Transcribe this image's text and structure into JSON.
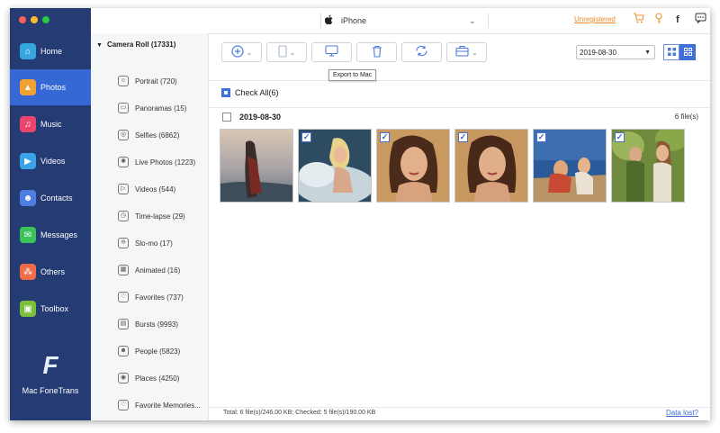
{
  "window": {
    "device_name": "iPhone"
  },
  "header": {
    "unregistered_label": "Unregistered",
    "facebook_glyph": "f"
  },
  "nav": {
    "items": [
      {
        "label": "Home",
        "icon": "home-icon",
        "color": "#35a6e0",
        "glyph": "⌂"
      },
      {
        "label": "Photos",
        "icon": "photos-icon",
        "color": "#f2a233",
        "glyph": "▲",
        "active": true
      },
      {
        "label": "Music",
        "icon": "music-icon",
        "color": "#e9456d",
        "glyph": "♫"
      },
      {
        "label": "Videos",
        "icon": "videos-icon",
        "color": "#3aa3e8",
        "glyph": "▶"
      },
      {
        "label": "Contacts",
        "icon": "contacts-icon",
        "color": "#4e7fe0",
        "glyph": "☻"
      },
      {
        "label": "Messages",
        "icon": "messages-icon",
        "color": "#3cc25a",
        "glyph": "✉"
      },
      {
        "label": "Others",
        "icon": "others-icon",
        "color": "#ef6b4a",
        "glyph": "⁂"
      },
      {
        "label": "Toolbox",
        "icon": "toolbox-icon",
        "color": "#7bbe3c",
        "glyph": "▣"
      }
    ],
    "brand": "Mac FoneTrans",
    "brand_glyph": "F"
  },
  "sidebar": {
    "header": "Camera Roll (17331)",
    "items": [
      "Portrait (720)",
      "Panoramas (15)",
      "Selfies (6862)",
      "Live Photos (1223)",
      "Videos (544)",
      "Time-lapse (29)",
      "Slo-mo (17)",
      "Animated (16)",
      "Favorites (737)",
      "Bursts (9993)",
      "People (5823)",
      "Places (4250)",
      "Favorite Memories..."
    ]
  },
  "toolbar": {
    "tooltip": "Export to Mac",
    "date_value": "2019-08-30"
  },
  "content": {
    "check_all": "Check All(6)",
    "group_date": "2019-08-30",
    "group_count": "6 file(s)",
    "thumbnails": [
      {
        "checked": false
      },
      {
        "checked": true
      },
      {
        "checked": true
      },
      {
        "checked": true
      },
      {
        "checked": true
      },
      {
        "checked": true
      }
    ]
  },
  "status": {
    "text": "Total: 6 file(s)/246.00 KB; Checked: 5 file(s)/190.00 KB",
    "data_lost": "Data lost?"
  },
  "colors": {
    "nav_bg": "#243b73",
    "nav_active": "#3568d4",
    "accent": "#3f6fd8",
    "warning": "#e88a2c"
  }
}
